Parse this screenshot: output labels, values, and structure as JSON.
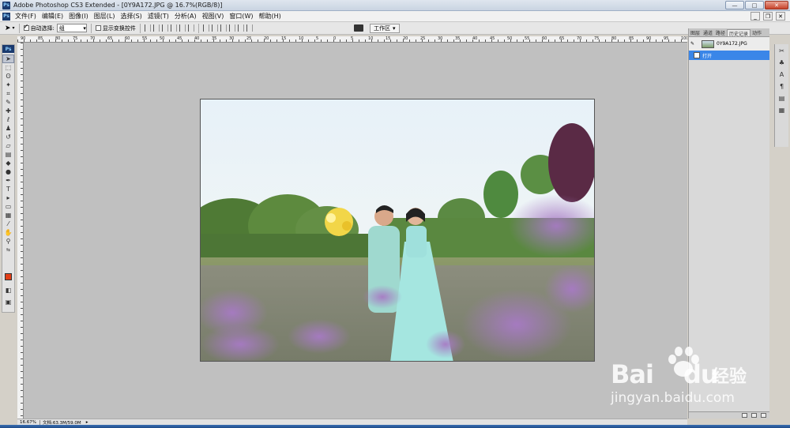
{
  "window": {
    "title": "Adobe Photoshop CS3 Extended - [0Y9A172.JPG @ 16.7%(RGB/8)]",
    "app_icon": "Ps",
    "controls": [
      "minimize-icon",
      "maximize-icon",
      "close-icon"
    ]
  },
  "menu": {
    "items": [
      "文件(F)",
      "编辑(E)",
      "图像(I)",
      "图层(L)",
      "选择(S)",
      "滤镜(T)",
      "分析(A)",
      "视图(V)",
      "窗口(W)",
      "帮助(H)"
    ]
  },
  "options": {
    "auto_select_label": "自动选择:",
    "auto_select_checked": true,
    "auto_select_value": "组",
    "show_transform_label": "显示变换控件",
    "show_transform_checked": false,
    "workspace_label": "工作区"
  },
  "toolbox": {
    "logo": "Ps",
    "tools": [
      "move-tool-icon",
      "marquee-tool-icon",
      "lasso-tool-icon",
      "magic-wand-icon",
      "crop-tool-icon",
      "slice-tool-icon",
      "healing-brush-icon",
      "brush-tool-icon",
      "clone-stamp-icon",
      "history-brush-icon",
      "eraser-icon",
      "gradient-tool-icon",
      "blur-tool-icon",
      "dodge-tool-icon",
      "pen-tool-icon",
      "type-tool-icon",
      "path-select-icon",
      "shape-tool-icon",
      "notes-tool-icon",
      "eyedropper-icon",
      "hand-tool-icon",
      "zoom-tool-icon"
    ],
    "foreground_color": "#e23d16"
  },
  "ruler": {
    "top_numbers": [
      "90",
      "85",
      "80",
      "75",
      "70",
      "65",
      "60",
      "55",
      "50",
      "45",
      "40",
      "35",
      "30",
      "25",
      "20",
      "15",
      "10",
      "5",
      "0",
      "5",
      "10",
      "15",
      "20",
      "25",
      "30",
      "35",
      "40",
      "45",
      "50",
      "55",
      "60",
      "65",
      "70",
      "75",
      "80",
      "85",
      "90",
      "95",
      "100"
    ]
  },
  "status": {
    "zoom": "16.67%",
    "doc_size": "文档:63.3M/59.0M"
  },
  "history_panel": {
    "tabs": [
      "图层",
      "通道",
      "路径",
      "历史记录",
      "动作"
    ],
    "active_tab": "历史记录",
    "snapshot_name": "0Y9A172.JPG",
    "states": [
      "打开"
    ]
  },
  "watermark": {
    "brand": "Bai",
    "brand_suffix": "du",
    "jingyan": "经验",
    "url": "jingyan.baidu.com"
  }
}
